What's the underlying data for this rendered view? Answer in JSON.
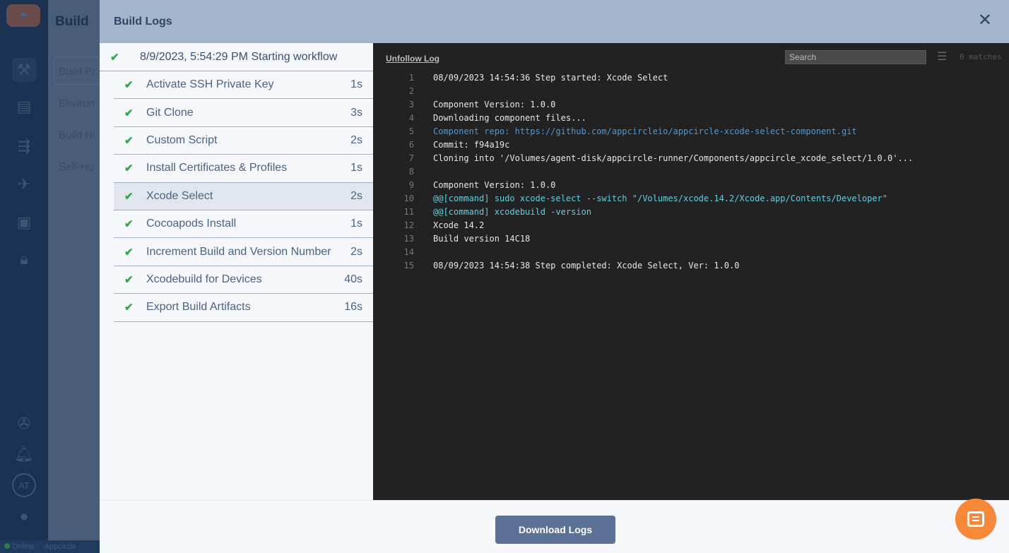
{
  "app": {
    "section_title": "Build",
    "nav": [
      "Build Pr",
      "Environ",
      "Build Hi",
      "Self-Ho"
    ],
    "avatar_initials": "AT",
    "status_online": "Online",
    "status_org": "Appcircle"
  },
  "modal": {
    "title": "Build Logs",
    "close_icon": "close-icon"
  },
  "steps": {
    "header": {
      "label": "8/9/2023, 5:54:29 PM Starting workflow",
      "status": "success"
    },
    "items": [
      {
        "name": "Activate SSH Private Key",
        "duration": "1s",
        "status": "success"
      },
      {
        "name": "Git Clone",
        "duration": "3s",
        "status": "success"
      },
      {
        "name": "Custom Script",
        "duration": "2s",
        "status": "success"
      },
      {
        "name": "Install Certificates & Profiles",
        "duration": "1s",
        "status": "success"
      },
      {
        "name": "Xcode Select",
        "duration": "2s",
        "status": "success",
        "selected": true
      },
      {
        "name": "Cocoapods Install",
        "duration": "1s",
        "status": "success"
      },
      {
        "name": "Increment Build and Version Number",
        "duration": "2s",
        "status": "success"
      },
      {
        "name": "Xcodebuild for Devices",
        "duration": "40s",
        "status": "success"
      },
      {
        "name": "Export Build Artifacts",
        "duration": "16s",
        "status": "success"
      }
    ]
  },
  "log": {
    "unfollow_label": "Unfollow Log",
    "search_placeholder": "Search",
    "matches": "0 matches",
    "lines": [
      {
        "n": "1",
        "t": "08/09/2023 14:54:36 Step started: Xcode Select",
        "k": ""
      },
      {
        "n": "2",
        "t": "",
        "k": ""
      },
      {
        "n": "3",
        "t": "Component Version: 1.0.0",
        "k": ""
      },
      {
        "n": "4",
        "t": "Downloading component files...",
        "k": ""
      },
      {
        "n": "5",
        "t": "Component repo: https://github.com/appcircleio/appcircle-xcode-select-component.git",
        "k": "link"
      },
      {
        "n": "6",
        "t": "Commit: f94a19c",
        "k": ""
      },
      {
        "n": "7",
        "t": "Cloning into '/Volumes/agent-disk/appcircle-runner/Components/appcircle_xcode_select/1.0.0'...",
        "k": ""
      },
      {
        "n": "8",
        "t": "",
        "k": ""
      },
      {
        "n": "9",
        "t": "Component Version: 1.0.0",
        "k": ""
      },
      {
        "n": "10",
        "t": "@@[command] sudo xcode-select --switch \"/Volumes/xcode.14.2/Xcode.app/Contents/Developer\"",
        "k": "cmd"
      },
      {
        "n": "11",
        "t": "@@[command] xcodebuild -version",
        "k": "cmd"
      },
      {
        "n": "12",
        "t": "Xcode 14.2",
        "k": ""
      },
      {
        "n": "13",
        "t": "Build version 14C18",
        "k": ""
      },
      {
        "n": "14",
        "t": "",
        "k": ""
      },
      {
        "n": "15",
        "t": "08/09/2023 14:54:38 Step completed: Xcode Select, Ver: 1.0.0",
        "k": ""
      }
    ]
  },
  "footer": {
    "download_label": "Download Logs"
  },
  "colors": {
    "success": "#2ea84a",
    "accent": "#5b7196",
    "chat": "#f7883a"
  }
}
